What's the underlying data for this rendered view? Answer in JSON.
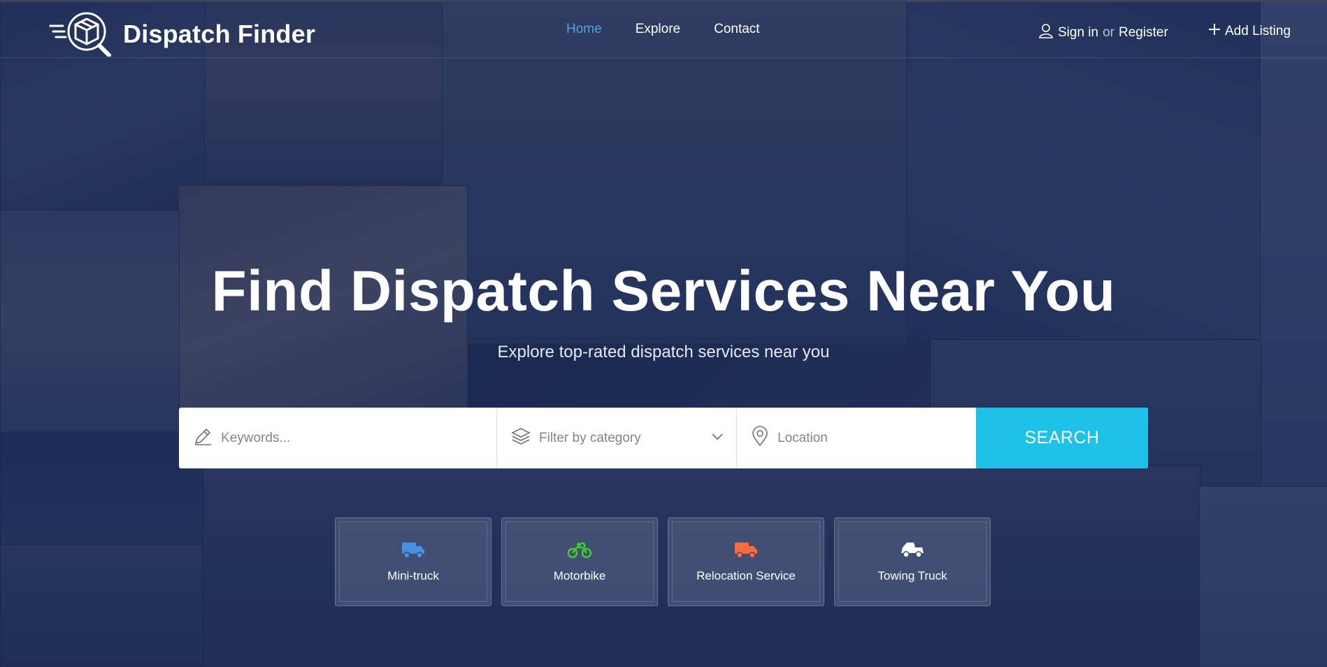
{
  "brand": {
    "name": "Dispatch Finder"
  },
  "nav": {
    "items": [
      {
        "label": "Home",
        "active": true
      },
      {
        "label": "Explore",
        "active": false
      },
      {
        "label": "Contact",
        "active": false
      }
    ]
  },
  "account": {
    "sign_in": "Sign in",
    "or": "or",
    "register": "Register",
    "add_listing": "Add Listing"
  },
  "hero": {
    "title": "Find Dispatch Services Near You",
    "subtitle": "Explore top-rated dispatch services near you"
  },
  "search": {
    "keywords_placeholder": "Keywords...",
    "category_placeholder": "Filter by category",
    "location_placeholder": "Location",
    "button_label": "SEARCH"
  },
  "categories": [
    {
      "label": "Mini-truck",
      "icon": "truck-icon",
      "color": "#4a90e2"
    },
    {
      "label": "Motorbike",
      "icon": "motorbike-icon",
      "color": "#3dd12b"
    },
    {
      "label": "Relocation Service",
      "icon": "moving-truck-icon",
      "color": "#ff6a3d"
    },
    {
      "label": "Towing Truck",
      "icon": "tow-truck-icon",
      "color": "#ffffff"
    }
  ],
  "colors": {
    "accent": "#1ec2e8",
    "nav_active": "#4aa5e2",
    "overlay": "#16244e"
  }
}
